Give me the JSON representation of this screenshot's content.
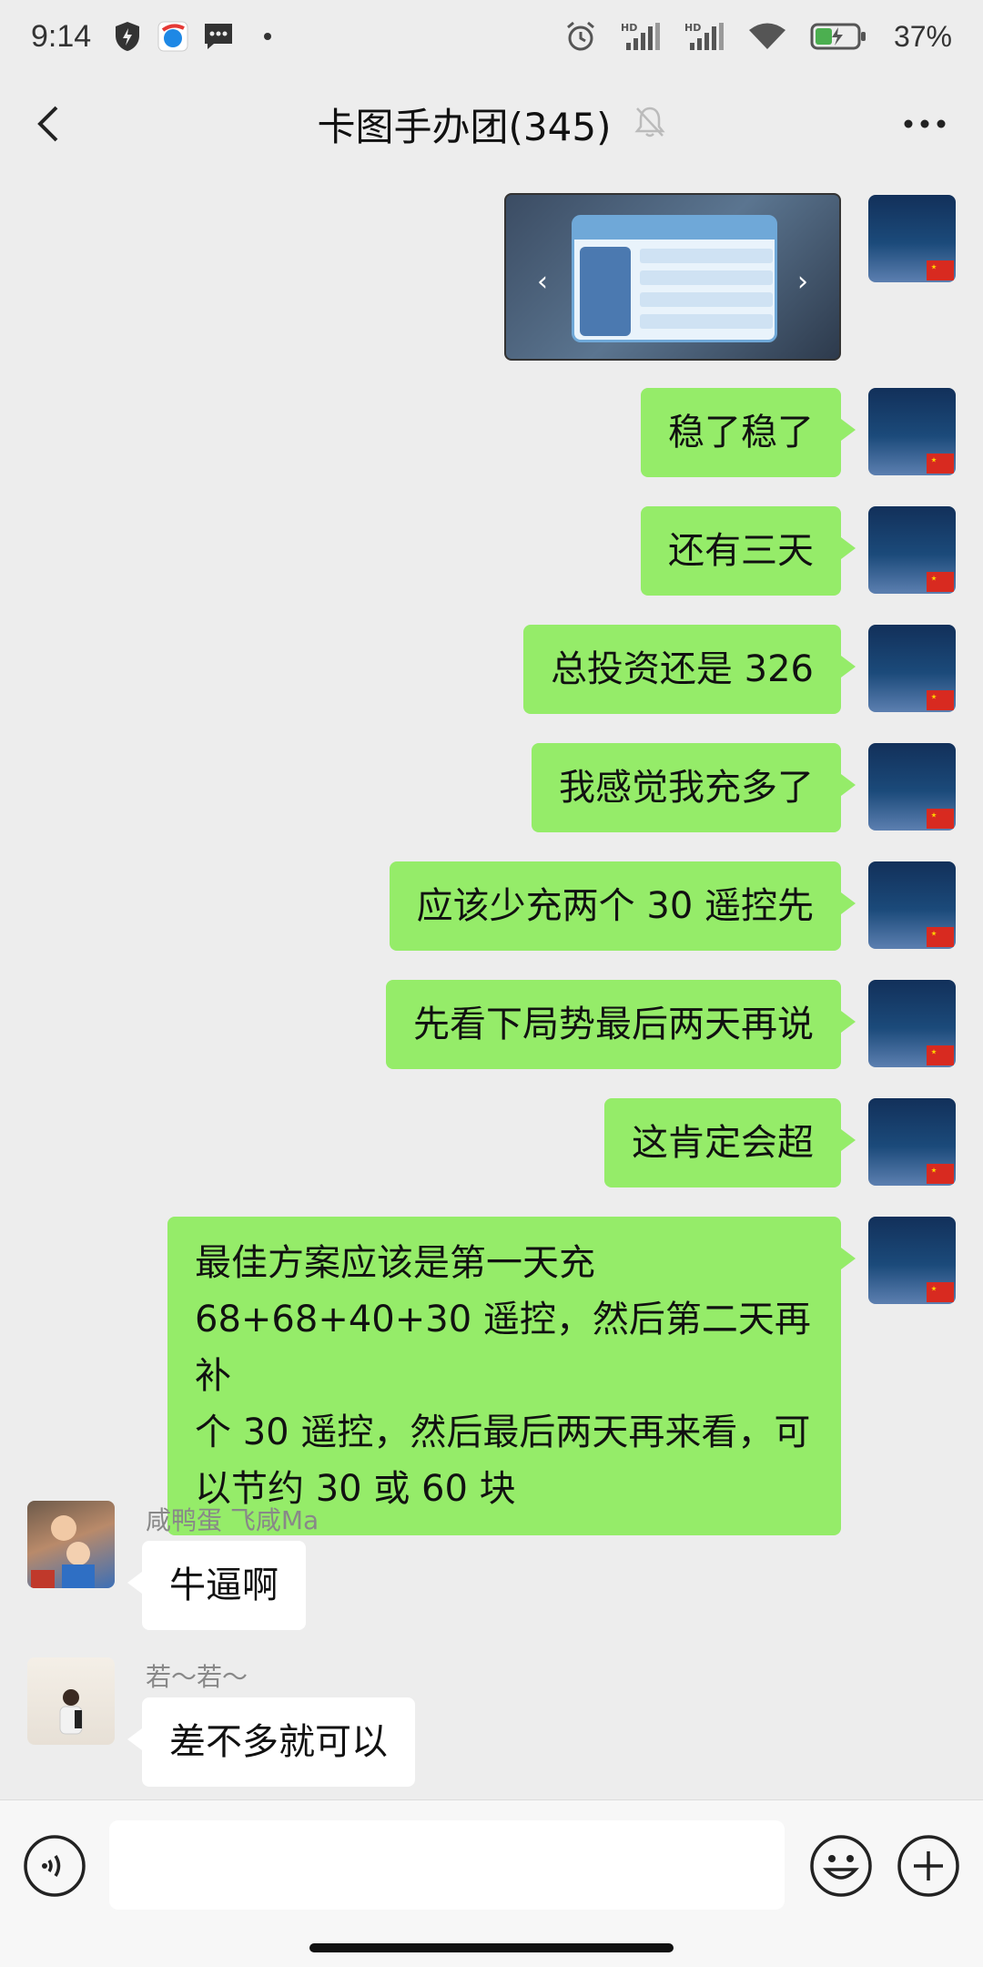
{
  "status_bar": {
    "time": "9:14",
    "battery_percent": "37%",
    "icons": [
      "shield-icon",
      "browser-icon",
      "sms-icon",
      "alarm-icon",
      "hd-signal-icon",
      "hd-signal-icon",
      "wifi-icon",
      "battery-icon"
    ],
    "hd_label": "HD"
  },
  "nav": {
    "title": "卡图手办团(345)",
    "back_icon": "chevron-left-icon",
    "mute_icon": "bell-off-icon",
    "more_icon": "more-icon"
  },
  "messages": [
    {
      "type": "image",
      "from": "self",
      "description": "game-screenshot"
    },
    {
      "type": "text",
      "from": "self",
      "text": "稳了稳了"
    },
    {
      "type": "text",
      "from": "self",
      "text": "还有三天"
    },
    {
      "type": "text",
      "from": "self",
      "text": "总投资还是 326"
    },
    {
      "type": "text",
      "from": "self",
      "text": "我感觉我充多了"
    },
    {
      "type": "text",
      "from": "self",
      "text": "应该少充两个 30 遥控先"
    },
    {
      "type": "text",
      "from": "self",
      "text": "先看下局势最后两天再说"
    },
    {
      "type": "text",
      "from": "self",
      "text": "这肯定会超"
    },
    {
      "type": "text",
      "from": "self",
      "lines": [
        "最佳方案应该是第一天充",
        "68+68+40+30 遥控，然后第二天再补",
        "个 30 遥控，然后最后两天再来看，可",
        "以节约 30 或 60 块"
      ]
    },
    {
      "type": "text",
      "from": "other",
      "sender": "咸鸭蛋 飞咸Ma",
      "text": "牛逼啊"
    },
    {
      "type": "text",
      "from": "other",
      "sender": "若～若～",
      "text": "差不多就可以"
    }
  ],
  "input_bar": {
    "voice_icon": "voice-icon",
    "emoji_icon": "emoji-icon",
    "plus_icon": "plus-icon",
    "text": ""
  },
  "colors": {
    "background": "#ededed",
    "bubble_out": "#95ec69",
    "bubble_in": "#ffffff"
  }
}
